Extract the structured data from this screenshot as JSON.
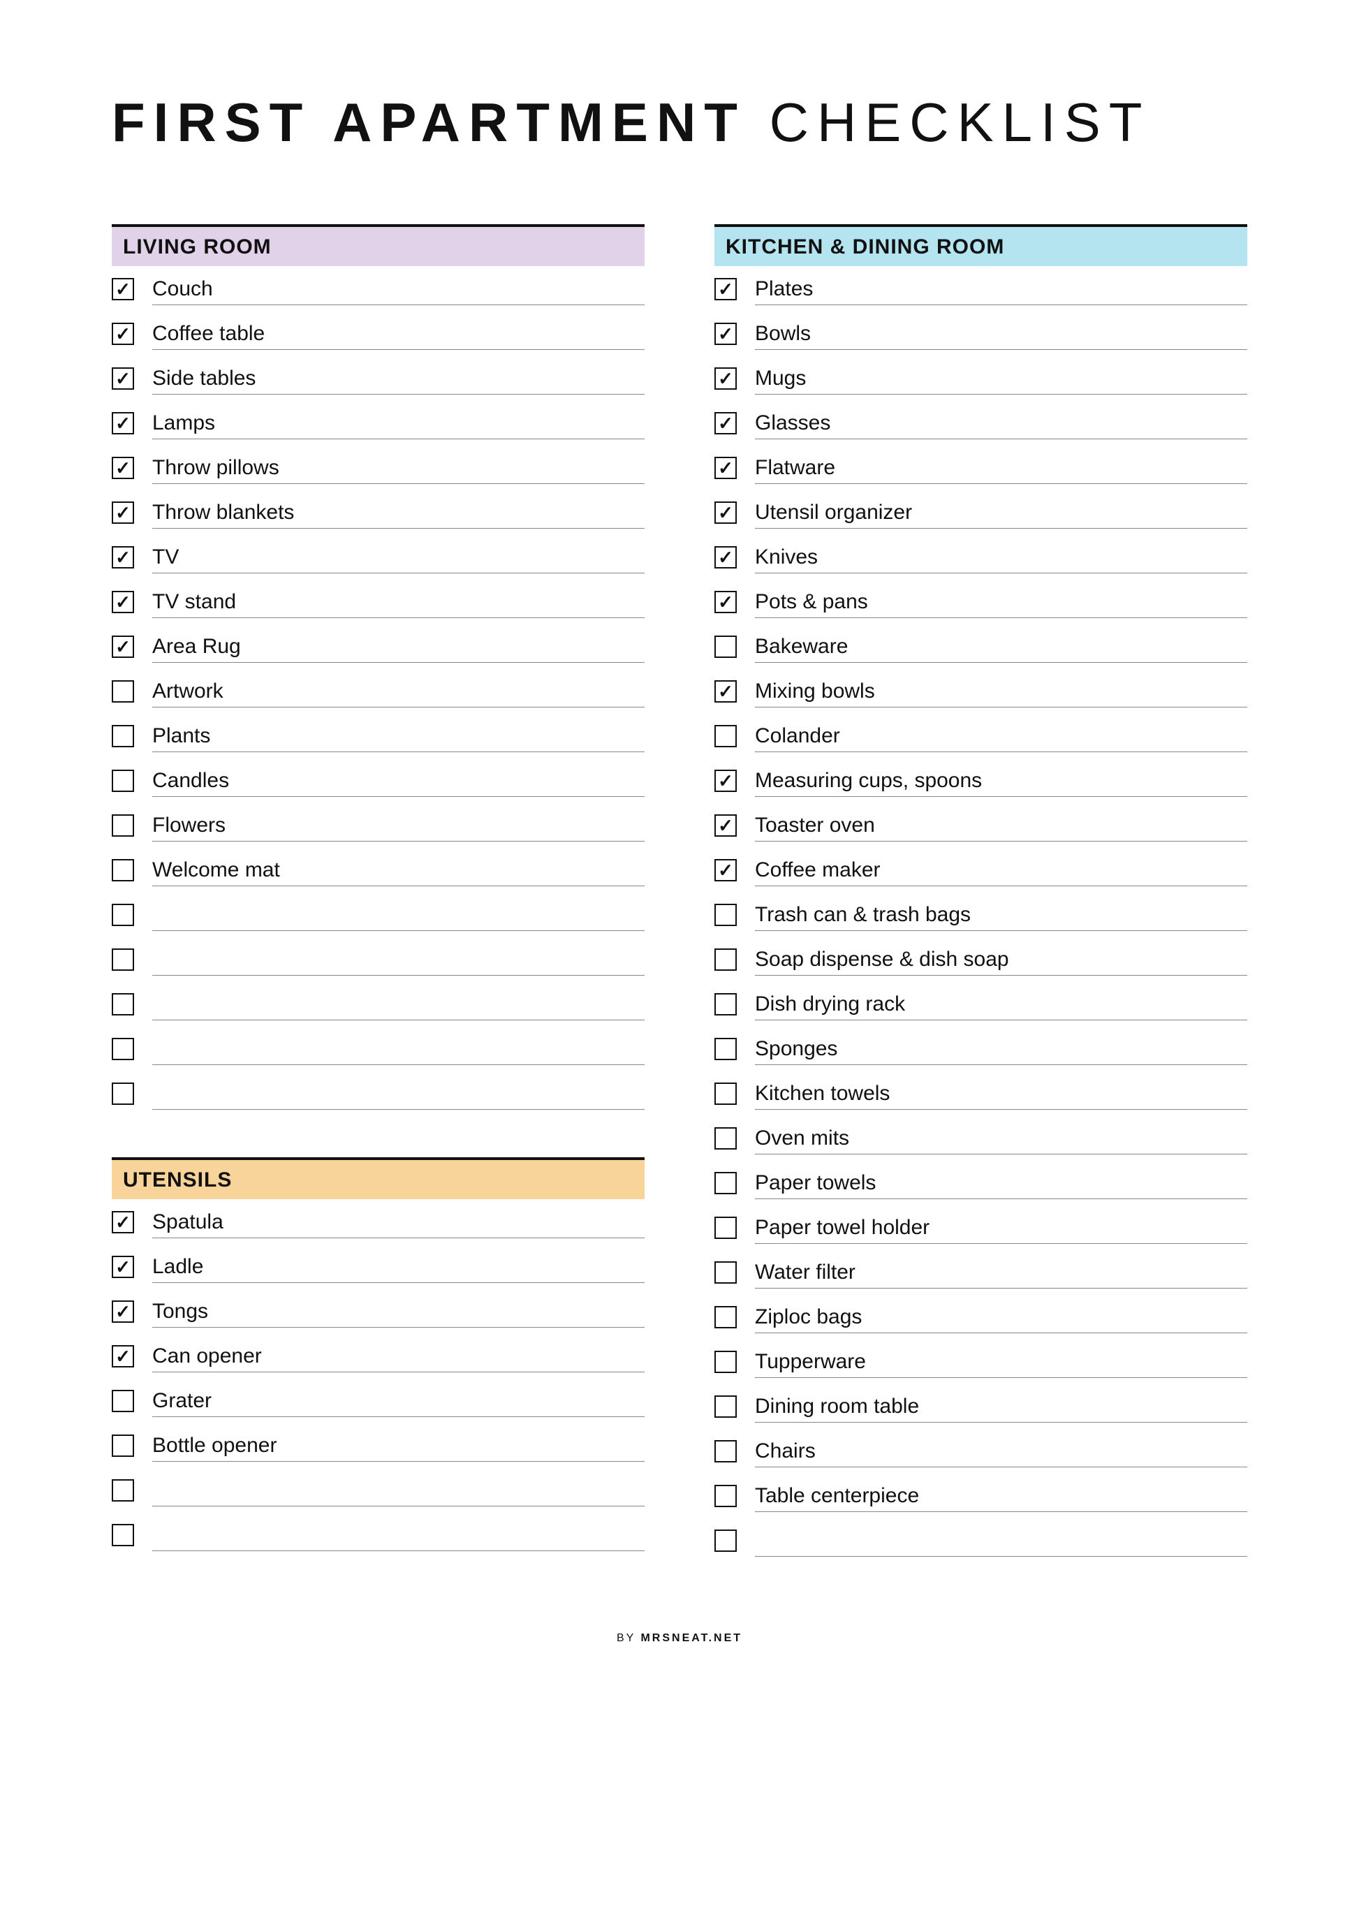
{
  "title_bold": "FIRST APARTMENT",
  "title_thin": " CHECKLIST",
  "footer_by": "BY ",
  "footer_site": "MRSNEAT.NET",
  "sections": [
    {
      "id": "living-room",
      "column": 0,
      "title": "LIVING ROOM",
      "bg": "#e2d2e9",
      "items": [
        {
          "label": "Couch",
          "checked": true
        },
        {
          "label": "Coffee table",
          "checked": true
        },
        {
          "label": "Side tables",
          "checked": true
        },
        {
          "label": "Lamps",
          "checked": true
        },
        {
          "label": "Throw pillows",
          "checked": true
        },
        {
          "label": "Throw blankets",
          "checked": true
        },
        {
          "label": "TV",
          "checked": true
        },
        {
          "label": "TV stand",
          "checked": true
        },
        {
          "label": "Area Rug",
          "checked": true
        },
        {
          "label": "Artwork",
          "checked": false
        },
        {
          "label": "Plants",
          "checked": false
        },
        {
          "label": "Candles",
          "checked": false
        },
        {
          "label": "Flowers",
          "checked": false
        },
        {
          "label": "Welcome mat",
          "checked": false
        },
        {
          "label": "",
          "checked": false
        },
        {
          "label": "",
          "checked": false
        },
        {
          "label": "",
          "checked": false
        },
        {
          "label": "",
          "checked": false
        },
        {
          "label": "",
          "checked": false
        }
      ]
    },
    {
      "id": "utensils",
      "column": 0,
      "title": "UTENSILS",
      "bg": "#f9d49a",
      "items": [
        {
          "label": "Spatula",
          "checked": true
        },
        {
          "label": "Ladle",
          "checked": true
        },
        {
          "label": "Tongs",
          "checked": true
        },
        {
          "label": "Can opener",
          "checked": true
        },
        {
          "label": "Grater",
          "checked": false
        },
        {
          "label": "Bottle opener",
          "checked": false
        },
        {
          "label": "",
          "checked": false
        },
        {
          "label": "",
          "checked": false
        }
      ]
    },
    {
      "id": "kitchen",
      "column": 1,
      "title": "KITCHEN & DINING ROOM",
      "bg": "#b4e4ef",
      "items": [
        {
          "label": "Plates",
          "checked": true
        },
        {
          "label": "Bowls",
          "checked": true
        },
        {
          "label": "Mugs",
          "checked": true
        },
        {
          "label": "Glasses",
          "checked": true
        },
        {
          "label": "Flatware",
          "checked": true
        },
        {
          "label": "Utensil organizer",
          "checked": true
        },
        {
          "label": "Knives",
          "checked": true
        },
        {
          "label": "Pots & pans",
          "checked": true
        },
        {
          "label": "Bakeware",
          "checked": false
        },
        {
          "label": "Mixing bowls",
          "checked": true
        },
        {
          "label": "Colander",
          "checked": false
        },
        {
          "label": "Measuring cups, spoons",
          "checked": true
        },
        {
          "label": "Toaster oven",
          "checked": true
        },
        {
          "label": "Coffee maker",
          "checked": true
        },
        {
          "label": "Trash can & trash bags",
          "checked": false
        },
        {
          "label": "Soap dispense & dish soap",
          "checked": false
        },
        {
          "label": "Dish drying rack",
          "checked": false
        },
        {
          "label": "Sponges",
          "checked": false
        },
        {
          "label": "Kitchen towels",
          "checked": false
        },
        {
          "label": "Oven mits",
          "checked": false
        },
        {
          "label": "Paper towels",
          "checked": false
        },
        {
          "label": "Paper towel holder",
          "checked": false
        },
        {
          "label": "Water filter",
          "checked": false
        },
        {
          "label": "Ziploc bags",
          "checked": false
        },
        {
          "label": "Tupperware",
          "checked": false
        },
        {
          "label": "Dining room table",
          "checked": false
        },
        {
          "label": "Chairs",
          "checked": false
        },
        {
          "label": "Table centerpiece",
          "checked": false
        },
        {
          "label": "",
          "checked": false
        }
      ]
    }
  ]
}
